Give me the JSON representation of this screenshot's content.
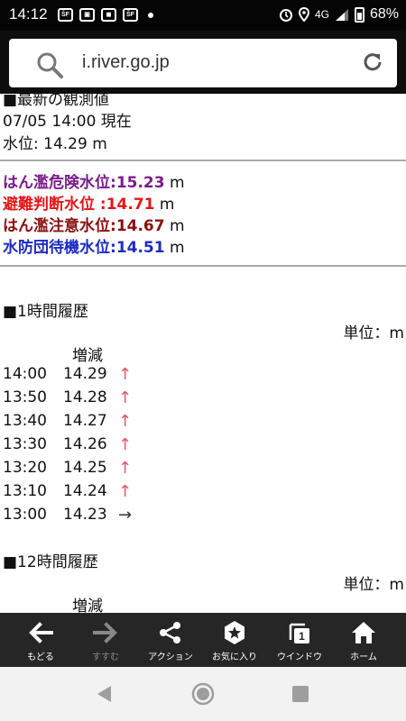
{
  "status": {
    "time": "14:12",
    "icons": [
      "notification-icon",
      "app-icon",
      "app-icon",
      "notification-icon"
    ],
    "network": "4G",
    "battery": "68%"
  },
  "browser": {
    "url": "i.river.go.jp"
  },
  "latest": {
    "heading": "■最新の観測値",
    "datetime": "07/05 14:00 現在",
    "water_level": "水位: 14.29 m"
  },
  "thresholds": [
    {
      "label": "はん濫危険水位:",
      "value": "15.23",
      "unit": " m",
      "color": "#7a1b8c"
    },
    {
      "label": "避難判断水位 :",
      "value": "14.71",
      "unit": " m",
      "color": "#e31616"
    },
    {
      "label": "はん濫注意水位:",
      "value": "14.67",
      "unit": " m",
      "color": "#8a1010"
    },
    {
      "label": "水防団待機水位:",
      "value": "14.51",
      "unit": " m",
      "color": "#1d2bc4"
    }
  ],
  "history1h": {
    "heading": "■1時間履歴",
    "unit": "単位：m",
    "change_header": "増減",
    "rows": [
      {
        "time": "14:00",
        "value": "14.29",
        "trend": "↑",
        "trend_kind": "up"
      },
      {
        "time": "13:50",
        "value": "14.28",
        "trend": "↑",
        "trend_kind": "up"
      },
      {
        "time": "13:40",
        "value": "14.27",
        "trend": "↑",
        "trend_kind": "up"
      },
      {
        "time": "13:30",
        "value": "14.26",
        "trend": "↑",
        "trend_kind": "up"
      },
      {
        "time": "13:20",
        "value": "14.25",
        "trend": "↑",
        "trend_kind": "up"
      },
      {
        "time": "13:10",
        "value": "14.24",
        "trend": "↑",
        "trend_kind": "up"
      },
      {
        "time": "13:00",
        "value": "14.23",
        "trend": "→",
        "trend_kind": "flat"
      }
    ]
  },
  "history12h": {
    "heading": "■12時間履歴",
    "unit": "単位：m",
    "change_header": "増減"
  },
  "bottom_nav": [
    {
      "name": "back",
      "label": "もどる",
      "icon": "arrow-left-icon",
      "enabled": true
    },
    {
      "name": "forward",
      "label": "すすむ",
      "icon": "arrow-right-icon",
      "enabled": false
    },
    {
      "name": "action",
      "label": "アクション",
      "icon": "share-icon",
      "enabled": true
    },
    {
      "name": "favorites",
      "label": "お気に入り",
      "icon": "star-badge-icon",
      "enabled": true
    },
    {
      "name": "window",
      "label": "ウインドウ",
      "icon": "window-count-icon",
      "enabled": true,
      "count": "1"
    },
    {
      "name": "home",
      "label": "ホーム",
      "icon": "home-icon",
      "enabled": true
    }
  ]
}
